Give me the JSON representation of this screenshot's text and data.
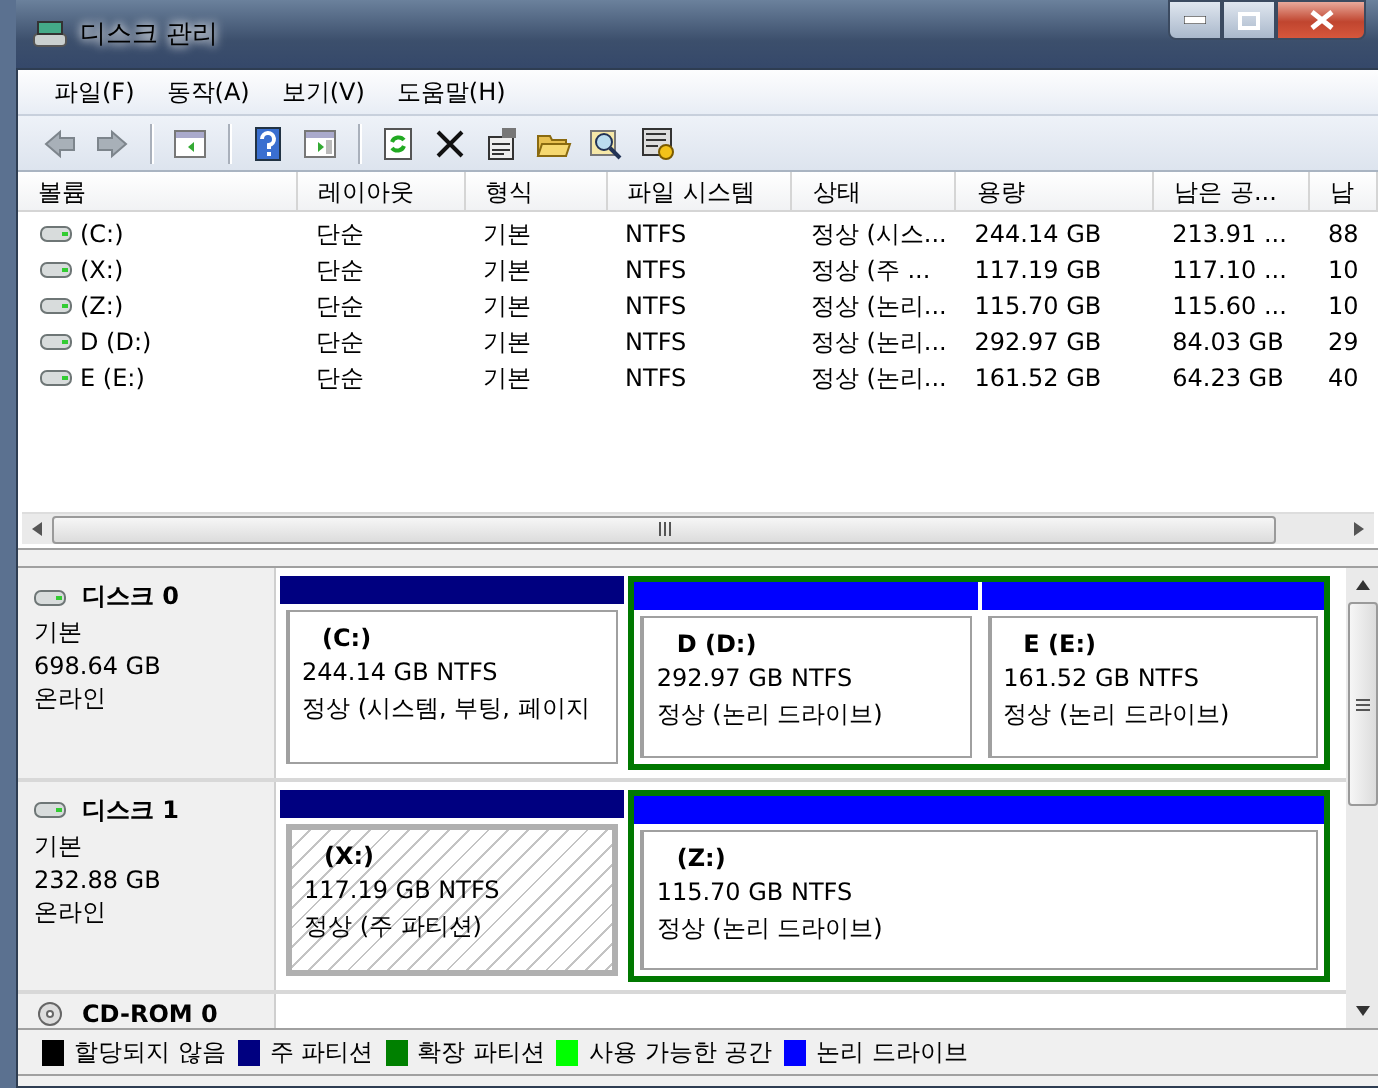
{
  "window": {
    "title": "디스크 관리"
  },
  "menu": [
    "파일(F)",
    "동작(A)",
    "보기(V)",
    "도움말(H)"
  ],
  "toolbar": [
    {
      "kind": "back"
    },
    {
      "kind": "forward"
    },
    {
      "kind": "sep"
    },
    {
      "kind": "tree"
    },
    {
      "kind": "sep"
    },
    {
      "kind": "help"
    },
    {
      "kind": "pane"
    },
    {
      "kind": "sep"
    },
    {
      "kind": "refresh"
    },
    {
      "kind": "delete"
    },
    {
      "kind": "properties"
    },
    {
      "kind": "open"
    },
    {
      "kind": "search"
    },
    {
      "kind": "settings"
    }
  ],
  "volumes": {
    "columns": [
      "볼륨",
      "레이아웃",
      "형식",
      "파일 시스템",
      "상태",
      "용량",
      "남은 공...",
      "남"
    ],
    "rows": [
      [
        "(C:)",
        "단순",
        "기본",
        "NTFS",
        "정상 (시스...",
        "244.14 GB",
        "213.91 ...",
        "88"
      ],
      [
        "(X:)",
        "단순",
        "기본",
        "NTFS",
        "정상 (주 ...",
        "117.19 GB",
        "117.10 ...",
        "10"
      ],
      [
        "(Z:)",
        "단순",
        "기본",
        "NTFS",
        "정상 (논리...",
        "115.70 GB",
        "115.60 ...",
        "10"
      ],
      [
        "D (D:)",
        "단순",
        "기본",
        "NTFS",
        "정상 (논리...",
        "292.97 GB",
        "84.03 GB",
        "29"
      ],
      [
        "E (E:)",
        "단순",
        "기본",
        "NTFS",
        "정상 (논리...",
        "161.52 GB",
        "64.23 GB",
        "40"
      ]
    ]
  },
  "disks": [
    {
      "name": "디스크 0",
      "type": "기본",
      "size": "698.64 GB",
      "status": "온라인",
      "partitions": [
        {
          "label": "(C:)",
          "size": "244.14 GB NTFS",
          "status": "정상 (시스템, 부팅, 페이지",
          "kind": "primary",
          "selected": false
        },
        {
          "label": "D  (D:)",
          "size": "292.97 GB NTFS",
          "status": "정상 (논리 드라이브)",
          "kind": "logical",
          "selected": false
        },
        {
          "label": "E  (E:)",
          "size": "161.52 GB NTFS",
          "status": "정상 (논리 드라이브)",
          "kind": "logical",
          "selected": false
        }
      ]
    },
    {
      "name": "디스크 1",
      "type": "기본",
      "size": "232.88 GB",
      "status": "온라인",
      "partitions": [
        {
          "label": "(X:)",
          "size": "117.19 GB NTFS",
          "status": "정상 (주 파티션)",
          "kind": "primary",
          "selected": true
        },
        {
          "label": "(Z:)",
          "size": "115.70 GB NTFS",
          "status": "정상 (논리 드라이브)",
          "kind": "logical",
          "selected": false
        }
      ]
    },
    {
      "name": "CD-ROM 0",
      "kind": "cdrom"
    }
  ],
  "legend": [
    {
      "label": "할당되지 않음",
      "color": "#000000"
    },
    {
      "label": "주 파티션",
      "color": "#000080"
    },
    {
      "label": "확장 파티션",
      "color": "#008000"
    },
    {
      "label": "사용 가능한 공간",
      "color": "#00ff00"
    },
    {
      "label": "논리 드라이브",
      "color": "#0000ff"
    }
  ]
}
